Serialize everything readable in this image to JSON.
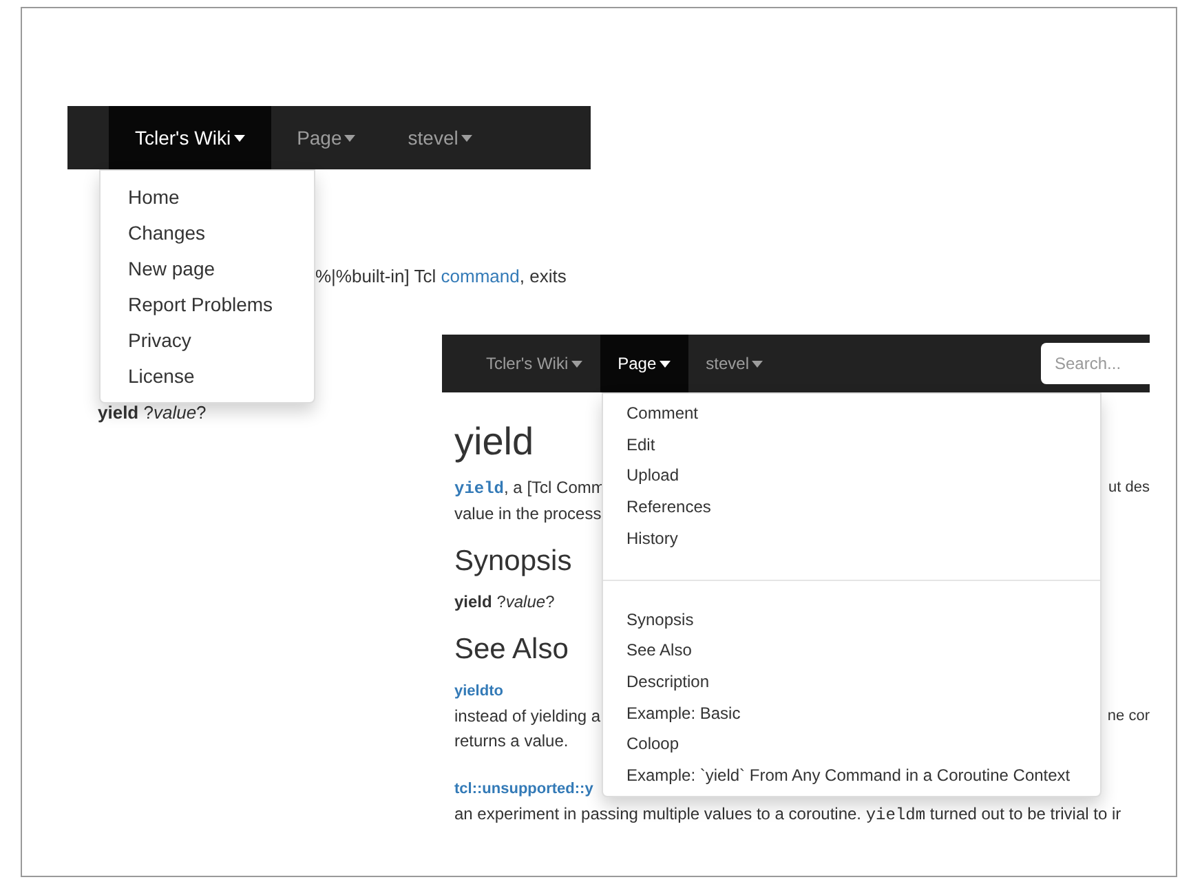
{
  "screenshots": [
    {
      "nav": [
        {
          "label": "Tcler's Wiki",
          "selected": true
        },
        {
          "label": "Page",
          "selected": false
        },
        {
          "label": "stevel",
          "selected": false
        }
      ],
      "menu": [
        [
          {
            "label": "Home"
          },
          {
            "label": "Changes"
          },
          {
            "label": "New page"
          },
          {
            "label": "Report Problems"
          },
          {
            "label": "Privacy"
          },
          {
            "label": "License"
          }
        ]
      ],
      "content": [
        {
          "kind": "behind",
          "parts": [
            {
              "kind": "text",
              "text": "%|%built-in] Tcl "
            },
            {
              "kind": "link",
              "text": "command"
            },
            {
              "kind": "text",
              "text": ", exits"
            }
          ]
        },
        {
          "kind": "line",
          "parts": [
            {
              "kind": "bold",
              "text": "yield"
            },
            {
              "kind": "text",
              "text": " ?"
            },
            {
              "kind": "italic",
              "text": "value"
            },
            {
              "kind": "text",
              "text": "?"
            }
          ]
        }
      ]
    },
    {
      "nav": [
        {
          "label": "Tcler's Wiki",
          "selected": false
        },
        {
          "label": "Page",
          "selected": true
        },
        {
          "label": "stevel",
          "selected": false
        }
      ],
      "search": {
        "placeholder": "Search..."
      },
      "menu": [
        [
          {
            "label": "Comment"
          },
          {
            "label": "Edit"
          },
          {
            "label": "Upload"
          },
          {
            "label": "References"
          },
          {
            "label": "History"
          }
        ],
        [
          {
            "label": "Synopsis"
          },
          {
            "label": "See Also"
          },
          {
            "label": "Description"
          },
          {
            "label": "Example: Basic"
          },
          {
            "label": "Coloop"
          },
          {
            "label": "Example: `yield` From Any Command in a Coroutine Context"
          }
        ]
      ],
      "content": [
        {
          "kind": "h1",
          "text": "yield"
        },
        {
          "kind": "line",
          "parts": [
            {
              "kind": "code-link",
              "text": "yield"
            },
            {
              "kind": "text",
              "text": ", a [Tcl Comm"
            }
          ],
          "right": "ut des"
        },
        {
          "kind": "line",
          "parts": [
            {
              "kind": "text",
              "text": "value in the process"
            }
          ]
        },
        {
          "kind": "h2",
          "text": "Synopsis"
        },
        {
          "kind": "line",
          "parts": [
            {
              "kind": "bold",
              "text": "yield"
            },
            {
              "kind": "text",
              "text": " ?"
            },
            {
              "kind": "italic",
              "text": "value"
            },
            {
              "kind": "text",
              "text": "?"
            }
          ]
        },
        {
          "kind": "h2",
          "text": "See Also"
        },
        {
          "kind": "line",
          "parts": [
            {
              "kind": "bold-link",
              "text": "yieldto"
            }
          ]
        },
        {
          "kind": "line",
          "parts": [
            {
              "kind": "text",
              "text": "instead of yielding a"
            }
          ],
          "right": "ne cor"
        },
        {
          "kind": "line",
          "parts": [
            {
              "kind": "text",
              "text": "returns a value."
            }
          ]
        },
        {
          "kind": "gap"
        },
        {
          "kind": "line",
          "parts": [
            {
              "kind": "bold-link",
              "text": "tcl::unsupported::y"
            }
          ]
        },
        {
          "kind": "line",
          "parts": [
            {
              "kind": "text",
              "text": "an experiment in passing multiple values to a coroutine. "
            },
            {
              "kind": "code",
              "text": "yieldm"
            },
            {
              "kind": "text",
              "text": " turned out to be trivial to ir"
            }
          ]
        }
      ]
    }
  ]
}
